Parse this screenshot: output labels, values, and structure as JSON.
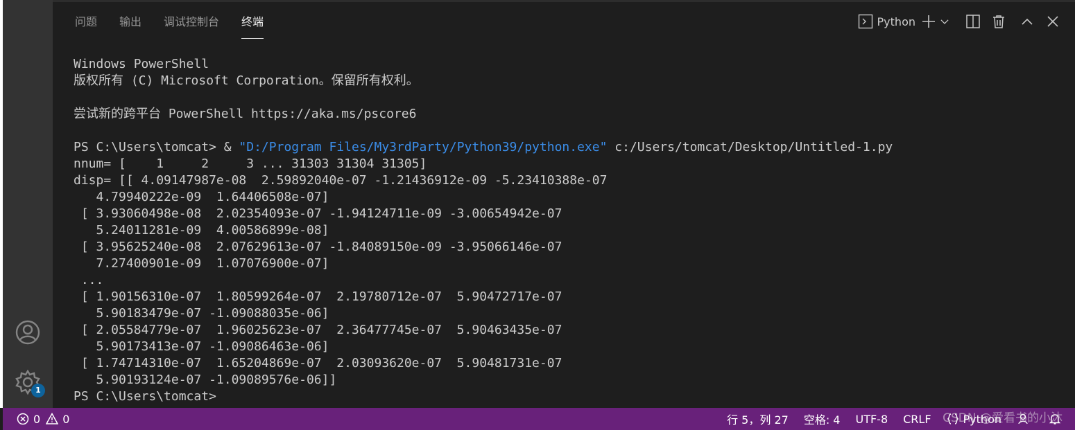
{
  "panel": {
    "tabs": [
      {
        "label": "问题"
      },
      {
        "label": "输出"
      },
      {
        "label": "调试控制台"
      },
      {
        "label": "终端",
        "active": true
      }
    ],
    "actions": {
      "terminal_select_icon": "terminal-icon",
      "terminal_select_label": "Python",
      "add_icon": "plus-icon",
      "dropdown_icon": "chevron-down-icon",
      "split_icon": "split-icon",
      "trash_icon": "trash-icon",
      "maximize_icon": "chevron-up-icon",
      "close_icon": "close-icon"
    }
  },
  "terminal": {
    "lines": [
      "Windows PowerShell",
      "版权所有 (C) Microsoft Corporation。保留所有权利。",
      "",
      "尝试新的跨平台 PowerShell https://aka.ms/pscore6",
      "",
      {
        "prefix": "PS C:\\Users\\tomcat> & ",
        "string": "\"D:/Program Files/My3rdParty/Python39/python.exe\"",
        "suffix": " c:/Users/tomcat/Desktop/Untitled-1.py"
      },
      "nnum= [    1     2     3 ... 31303 31304 31305]",
      "disp= [[ 4.09147987e-08  2.59892040e-07 -1.21436912e-09 -5.23410388e-07",
      "   4.79940222e-09  1.64406508e-07]",
      " [ 3.93060498e-08  2.02354093e-07 -1.94124711e-09 -3.00654942e-07",
      "   5.24011281e-09  4.00586899e-08]",
      " [ 3.95625240e-08  2.07629613e-07 -1.84089150e-09 -3.95066146e-07",
      "   7.27400901e-09  1.07076900e-07]",
      " ...",
      " [ 1.90156310e-07  1.80599264e-07  2.19780712e-07  5.90472717e-07",
      "   5.90183479e-07 -1.09088035e-06]",
      " [ 2.05584779e-07  1.96025623e-07  2.36477745e-07  5.90463435e-07",
      "   5.90173413e-07 -1.09086463e-06]",
      " [ 1.74714310e-07  1.65204869e-07  2.03093620e-07  5.90481731e-07",
      "   5.90193124e-07 -1.09089576e-06]]",
      "PS C:\\Users\\tomcat>"
    ]
  },
  "activity_bar": {
    "account_icon": "account-icon",
    "settings_icon": "gear-icon",
    "settings_badge": "1"
  },
  "status_bar": {
    "errors": "0",
    "warnings": "0",
    "position": "行 5，列 27",
    "indent": "空格: 4",
    "encoding": "UTF-8",
    "eol": "CRLF",
    "language": "Python"
  },
  "watermark": "CSDN @爱看书的小沐",
  "colors": {
    "status_bar": "#68217a",
    "terminal_string": "#3b8eea",
    "badge": "#0e639c"
  }
}
